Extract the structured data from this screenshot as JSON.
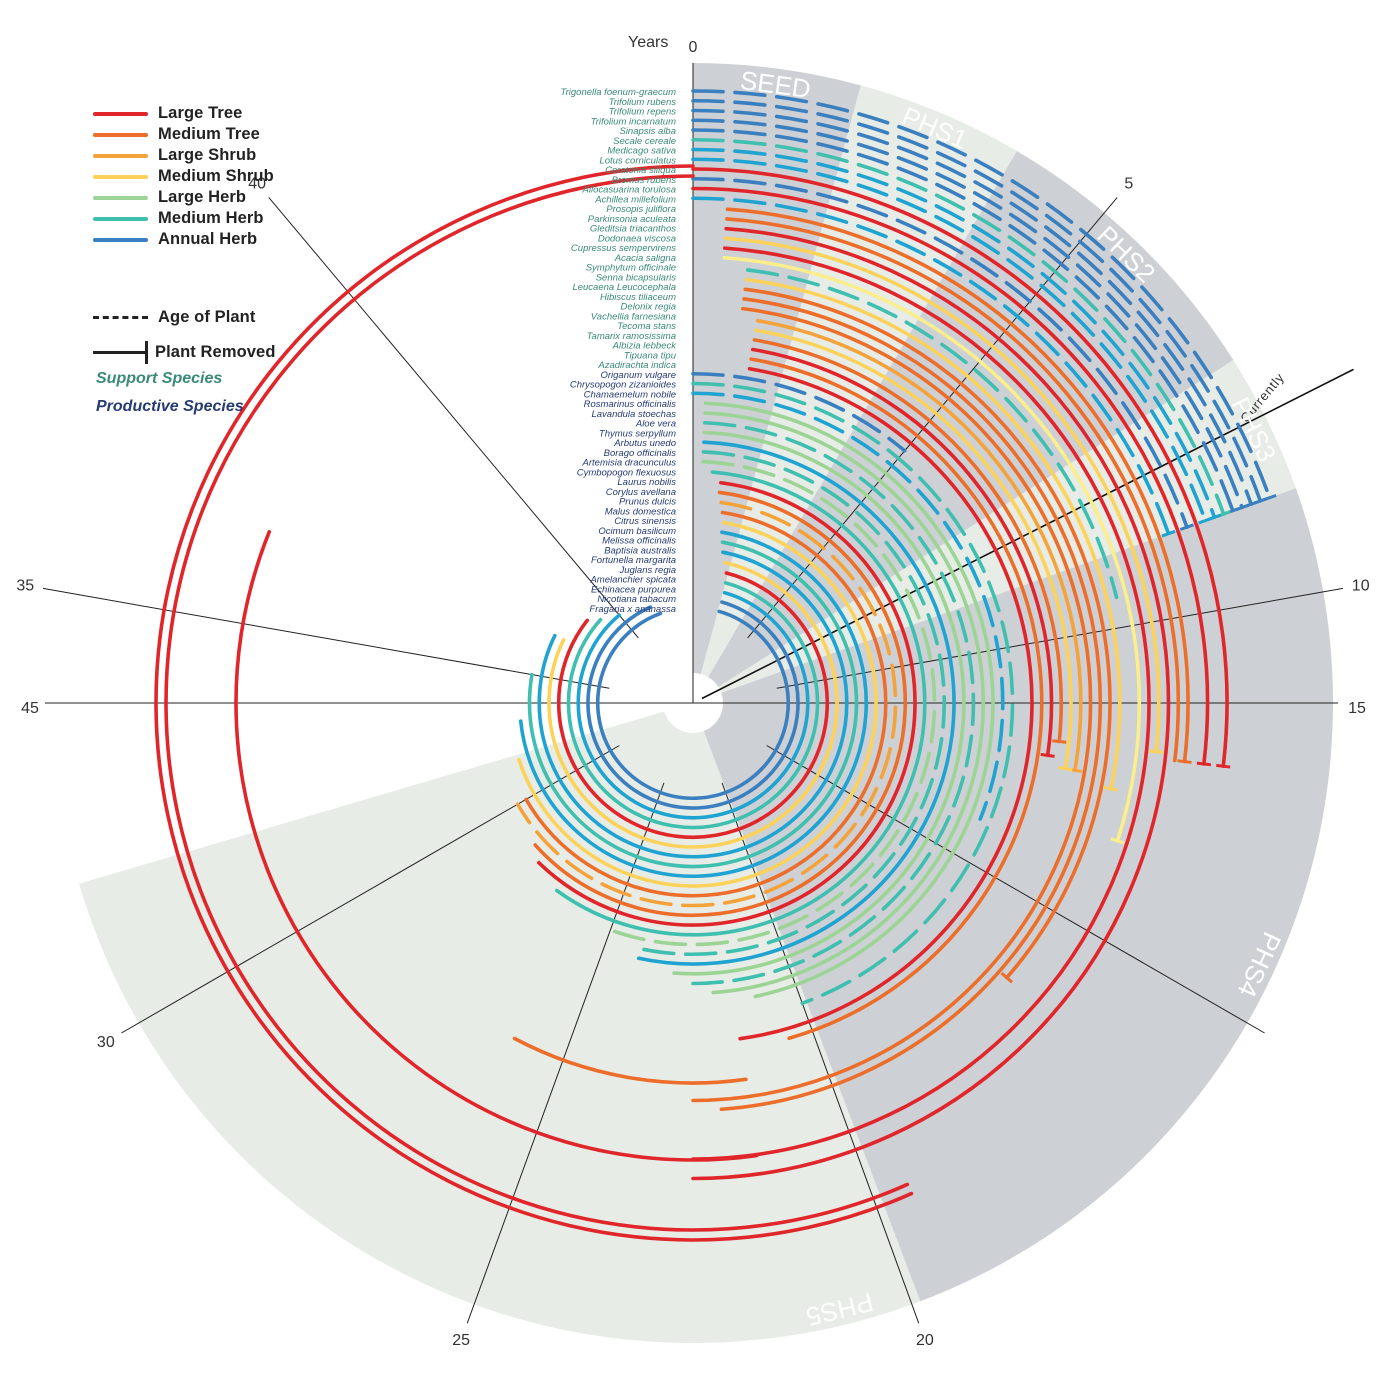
{
  "chart_data": {
    "type": "radial-timeline",
    "axis_label": "Years",
    "year_range": [
      0,
      45
    ],
    "direction": "clockwise-from-top",
    "axis_ticks": [
      0,
      5,
      10,
      15,
      20,
      25,
      30,
      35,
      40,
      45
    ],
    "currently_label": "Currently",
    "currently_year": 7.9,
    "phases": [
      {
        "name": "SEED",
        "start": 0,
        "end": 1.9,
        "shade": "#cdd0d4"
      },
      {
        "name": "PHS1",
        "start": 1.9,
        "end": 3.8,
        "shade": "#e7ece6"
      },
      {
        "name": "PHS2",
        "start": 3.8,
        "end": 7.2,
        "shade": "#cdd0d4"
      },
      {
        "name": "PHS3",
        "start": 7.2,
        "end": 8.8,
        "shade": "#e7ece6"
      },
      {
        "name": "PHS4",
        "start": 8.8,
        "end": 19.9,
        "shade": "#cdd0d4"
      },
      {
        "name": "PHS5",
        "start": 19.9,
        "end": 31.7,
        "shade": "#e7ece6"
      }
    ],
    "legend": {
      "types": [
        {
          "key": "large_tree",
          "label": "Large Tree",
          "color": "#e0262a"
        },
        {
          "key": "medium_tree",
          "label": "Medium Tree",
          "color": "#ec6e2a"
        },
        {
          "key": "large_shrub",
          "label": "Large Shrub",
          "color": "#f5a23a"
        },
        {
          "key": "medium_shrub",
          "label": "Medium Shrub",
          "color": "#fcd25a"
        },
        {
          "key": "large_herb",
          "label": "Large Herb",
          "color": "#9bd494"
        },
        {
          "key": "medium_herb",
          "label": "Medium Herb",
          "color": "#3fbfb0"
        },
        {
          "key": "annual_herb",
          "label": "Annual Herb",
          "color": "#3a7fbf"
        }
      ],
      "age_label": "Age of Plant",
      "removed_label": "Plant Removed",
      "support_label": "Support Species",
      "productive_label": "Productive Species",
      "support_color": "#3a8a79",
      "productive_color": "#253b73"
    },
    "extra_colors": {
      "pale_yellow": "#fbee8c",
      "light_blue": "#1fa3d1"
    },
    "species": [
      {
        "name": "Trigonella foenum-graecum",
        "group": "support",
        "type": "annual_herb",
        "start": 0,
        "end": 8.8,
        "dashed": true,
        "removed": true
      },
      {
        "name": "Trifolium rubens",
        "group": "support",
        "type": "annual_herb",
        "start": 0,
        "end": 8.8,
        "dashed": true,
        "removed": true
      },
      {
        "name": "Trifolium repens",
        "group": "support",
        "type": "annual_herb",
        "start": 0,
        "end": 8.8,
        "dashed": true,
        "removed": true
      },
      {
        "name": "Trifolium incarnatum",
        "group": "support",
        "type": "annual_herb",
        "start": 0,
        "end": 8.8,
        "dashed": true,
        "removed": true
      },
      {
        "name": "Sinapsis alba",
        "group": "support",
        "type": "annual_herb",
        "start": 0,
        "end": 8.8,
        "dashed": true,
        "removed": true
      },
      {
        "name": "Secale cereale",
        "group": "support",
        "type": "medium_herb",
        "start": 0,
        "end": 8.8,
        "dashed": true,
        "removed": true
      },
      {
        "name": "Medicago sativa",
        "group": "support",
        "type": "light_blue",
        "start": 0,
        "end": 8.8,
        "dashed": true,
        "removed": true
      },
      {
        "name": "Lotus corniculatus",
        "group": "support",
        "type": "light_blue",
        "start": 0,
        "end": 8.8,
        "dashed": true,
        "removed": true
      },
      {
        "name": "Ceratonia siliqua",
        "group": "support",
        "type": "large_tree",
        "start": 0,
        "end": 12.1,
        "dashed": false,
        "removed": true
      },
      {
        "name": "Bromus rubens",
        "group": "support",
        "type": "annual_herb",
        "start": 0,
        "end": 8.8,
        "dashed": true,
        "removed": true
      },
      {
        "name": "Allocasuarina torulosa",
        "group": "support",
        "type": "large_tree",
        "start": 0,
        "end": 12.1,
        "dashed": false,
        "removed": true
      },
      {
        "name": "Achillea millefolium",
        "group": "support",
        "type": "light_blue",
        "start": 0,
        "end": 8.8,
        "dashed": true,
        "removed": true
      },
      {
        "name": "Prosopis juliflora",
        "group": "support",
        "type": "medium_tree",
        "start": 0.5,
        "end": 12.1,
        "dashed": false,
        "removed": true
      },
      {
        "name": "Parkinsonia aculeata",
        "group": "support",
        "type": "medium_tree",
        "start": 0.5,
        "end": 12.1,
        "dashed": false,
        "removed": false
      },
      {
        "name": "Gleditsia triacanthos",
        "group": "support",
        "type": "large_tree",
        "start": 0.5,
        "end": 22.5,
        "dashed": false,
        "removed": false
      },
      {
        "name": "Dodonaea viscosa",
        "group": "support",
        "type": "medium_shrub",
        "start": 0.5,
        "end": 12.0,
        "dashed": false,
        "removed": true
      },
      {
        "name": "Cupressus sempervirens",
        "group": "support",
        "type": "large_tree",
        "start": 0.5,
        "end": 22.5,
        "dashed": false,
        "removed": false
      },
      {
        "name": "Acacia saligna",
        "group": "support",
        "type": "pale_yellow",
        "start": 0.5,
        "end": 13.5,
        "dashed": false,
        "removed": true
      },
      {
        "name": "Symphytum officinale",
        "group": "support",
        "type": "medium_herb",
        "start": 0.9,
        "end": 9.5,
        "dashed": true,
        "removed": false
      },
      {
        "name": "Senna bicapsularis",
        "group": "support",
        "type": "medium_shrub",
        "start": 0.9,
        "end": 12.7,
        "dashed": false,
        "removed": true
      },
      {
        "name": "Leucaena Leucocephala",
        "group": "support",
        "type": "medium_tree",
        "start": 0.9,
        "end": 16.4,
        "dashed": false,
        "removed": true
      },
      {
        "name": "Hibiscus tiliaceum",
        "group": "support",
        "type": "medium_tree",
        "start": 0.9,
        "end": 22.0,
        "dashed": false,
        "removed": false
      },
      {
        "name": "Delonix regia",
        "group": "support",
        "type": "medium_tree",
        "start": 0.9,
        "end": 22.5,
        "dashed": false,
        "removed": false
      },
      {
        "name": "Vachellia farnesiana",
        "group": "support",
        "type": "large_shrub",
        "start": 1.2,
        "end": 12.5,
        "dashed": false,
        "removed": true
      },
      {
        "name": "Tecoma stans",
        "group": "support",
        "type": "medium_shrub",
        "start": 1.2,
        "end": 12.5,
        "dashed": false,
        "removed": true
      },
      {
        "name": "Tamarix ramosissima",
        "group": "support",
        "type": "medium_tree",
        "start": 1.2,
        "end": 12.0,
        "dashed": false,
        "removed": true
      },
      {
        "name": "Albizia lebbeck",
        "group": "support",
        "type": "large_tree",
        "start": 1.2,
        "end": 12.3,
        "dashed": false,
        "removed": true
      },
      {
        "name": "Tipuana tipu",
        "group": "support",
        "type": "medium_tree",
        "start": 1.2,
        "end": 20.5,
        "dashed": false,
        "removed": false
      },
      {
        "name": "Azadirachta indica",
        "group": "support",
        "type": "large_tree",
        "start": 1.2,
        "end": 21.5,
        "dashed": false,
        "removed": false
      },
      {
        "name": "Origanum vulgare",
        "group": "productive",
        "type": "annual_herb",
        "start": 0,
        "end": 5.0,
        "dashed": true,
        "removed": false
      },
      {
        "name": "Chrysopogon zizanioides",
        "group": "productive",
        "type": "medium_herb",
        "start": 0,
        "end": 20.0,
        "dashed": true,
        "removed": false
      },
      {
        "name": "Chamaemelum nobile",
        "group": "productive",
        "type": "light_blue",
        "start": 0,
        "end": 14.0,
        "dashed": true,
        "removed": false
      },
      {
        "name": "Rosmarinus officinalis",
        "group": "productive",
        "type": "large_herb",
        "start": 0.3,
        "end": 21.0,
        "dashed": false,
        "removed": false
      },
      {
        "name": "Lavandula stoechas",
        "group": "productive",
        "type": "large_herb",
        "start": 0.3,
        "end": 22.0,
        "dashed": false,
        "removed": false
      },
      {
        "name": "Aloe vera",
        "group": "productive",
        "type": "medium_herb",
        "start": 0.3,
        "end": 22.5,
        "dashed": true,
        "removed": false
      },
      {
        "name": "Thymus serpyllum",
        "group": "productive",
        "type": "large_herb",
        "start": 0.3,
        "end": 23.0,
        "dashed": false,
        "removed": false
      },
      {
        "name": "Arbutus unedo",
        "group": "productive",
        "type": "light_blue",
        "start": 0.3,
        "end": 24.0,
        "dashed": false,
        "removed": false
      },
      {
        "name": "Borago officinalis",
        "group": "productive",
        "type": "medium_herb",
        "start": 0.3,
        "end": 24.0,
        "dashed": true,
        "removed": false
      },
      {
        "name": "Artemisia dracunculus",
        "group": "productive",
        "type": "large_herb",
        "start": 0.3,
        "end": 25.0,
        "dashed": true,
        "removed": false
      },
      {
        "name": "Cymbopogon flexuosus",
        "group": "productive",
        "type": "medium_herb",
        "start": 0.6,
        "end": 27.0,
        "dashed": false,
        "removed": false
      },
      {
        "name": "Laurus nobilis",
        "group": "productive",
        "type": "large_tree",
        "start": 0.9,
        "end": 28.0,
        "dashed": false,
        "removed": false
      },
      {
        "name": "Corylus avellana",
        "group": "productive",
        "type": "medium_tree",
        "start": 0.9,
        "end": 28.5,
        "dashed": false,
        "removed": false
      },
      {
        "name": "Prunus dulcis",
        "group": "productive",
        "type": "large_shrub",
        "start": 1.0,
        "end": 30.0,
        "dashed": true,
        "removed": false
      },
      {
        "name": "Malus domestica",
        "group": "productive",
        "type": "medium_tree",
        "start": 1.1,
        "end": 30.0,
        "dashed": false,
        "removed": false
      },
      {
        "name": "Citrus sinensis",
        "group": "productive",
        "type": "medium_shrub",
        "start": 1.2,
        "end": 31.5,
        "dashed": false,
        "removed": false
      },
      {
        "name": "Ocimum basilicum",
        "group": "productive",
        "type": "light_blue",
        "start": 1.2,
        "end": 33.0,
        "dashed": false,
        "removed": false
      },
      {
        "name": "Melissa officinalis",
        "group": "productive",
        "type": "medium_herb",
        "start": 1.3,
        "end": 35.0,
        "dashed": false,
        "removed": false
      },
      {
        "name": "Baptisia australis",
        "group": "productive",
        "type": "light_blue",
        "start": 1.4,
        "end": 37.0,
        "dashed": false,
        "removed": false
      },
      {
        "name": "Fortunella margarita",
        "group": "productive",
        "type": "medium_shrub",
        "start": 1.6,
        "end": 37.0,
        "dashed": false,
        "removed": false
      },
      {
        "name": "Juglans regia",
        "group": "productive",
        "type": "large_tree",
        "start": 1.8,
        "end": 38.5,
        "dashed": false,
        "removed": false
      },
      {
        "name": "Amelanchier spicata",
        "group": "productive",
        "type": "medium_herb",
        "start": 1.9,
        "end": 39.0,
        "dashed": false,
        "removed": false
      },
      {
        "name": "Echinacea purpurea",
        "group": "productive",
        "type": "light_blue",
        "start": 2.0,
        "end": 40.0,
        "dashed": false,
        "removed": false
      },
      {
        "name": "Nicotiana tabacum",
        "group": "productive",
        "type": "annual_herb",
        "start": 2.0,
        "end": 42.0,
        "dashed": false,
        "removed": false
      },
      {
        "name": "Fragaria x ananassa",
        "group": "productive",
        "type": "annual_herb",
        "start": 2.0,
        "end": 42.5,
        "dashed": false,
        "removed": false
      }
    ],
    "long_lived": [
      {
        "type": "large_tree",
        "start": 7.5,
        "end": 45,
        "ring": "outer1",
        "removed": true
      },
      {
        "type": "large_tree",
        "start": 7.5,
        "end": 45,
        "ring": "outer2",
        "removed": true
      },
      {
        "type": "large_tree",
        "start": 9.5,
        "end": 36.5,
        "ring": "outer3",
        "removed": false
      },
      {
        "type": "medium_tree",
        "start": 9.5,
        "end": 26.0,
        "ring": "outer4",
        "removed": false
      }
    ]
  }
}
